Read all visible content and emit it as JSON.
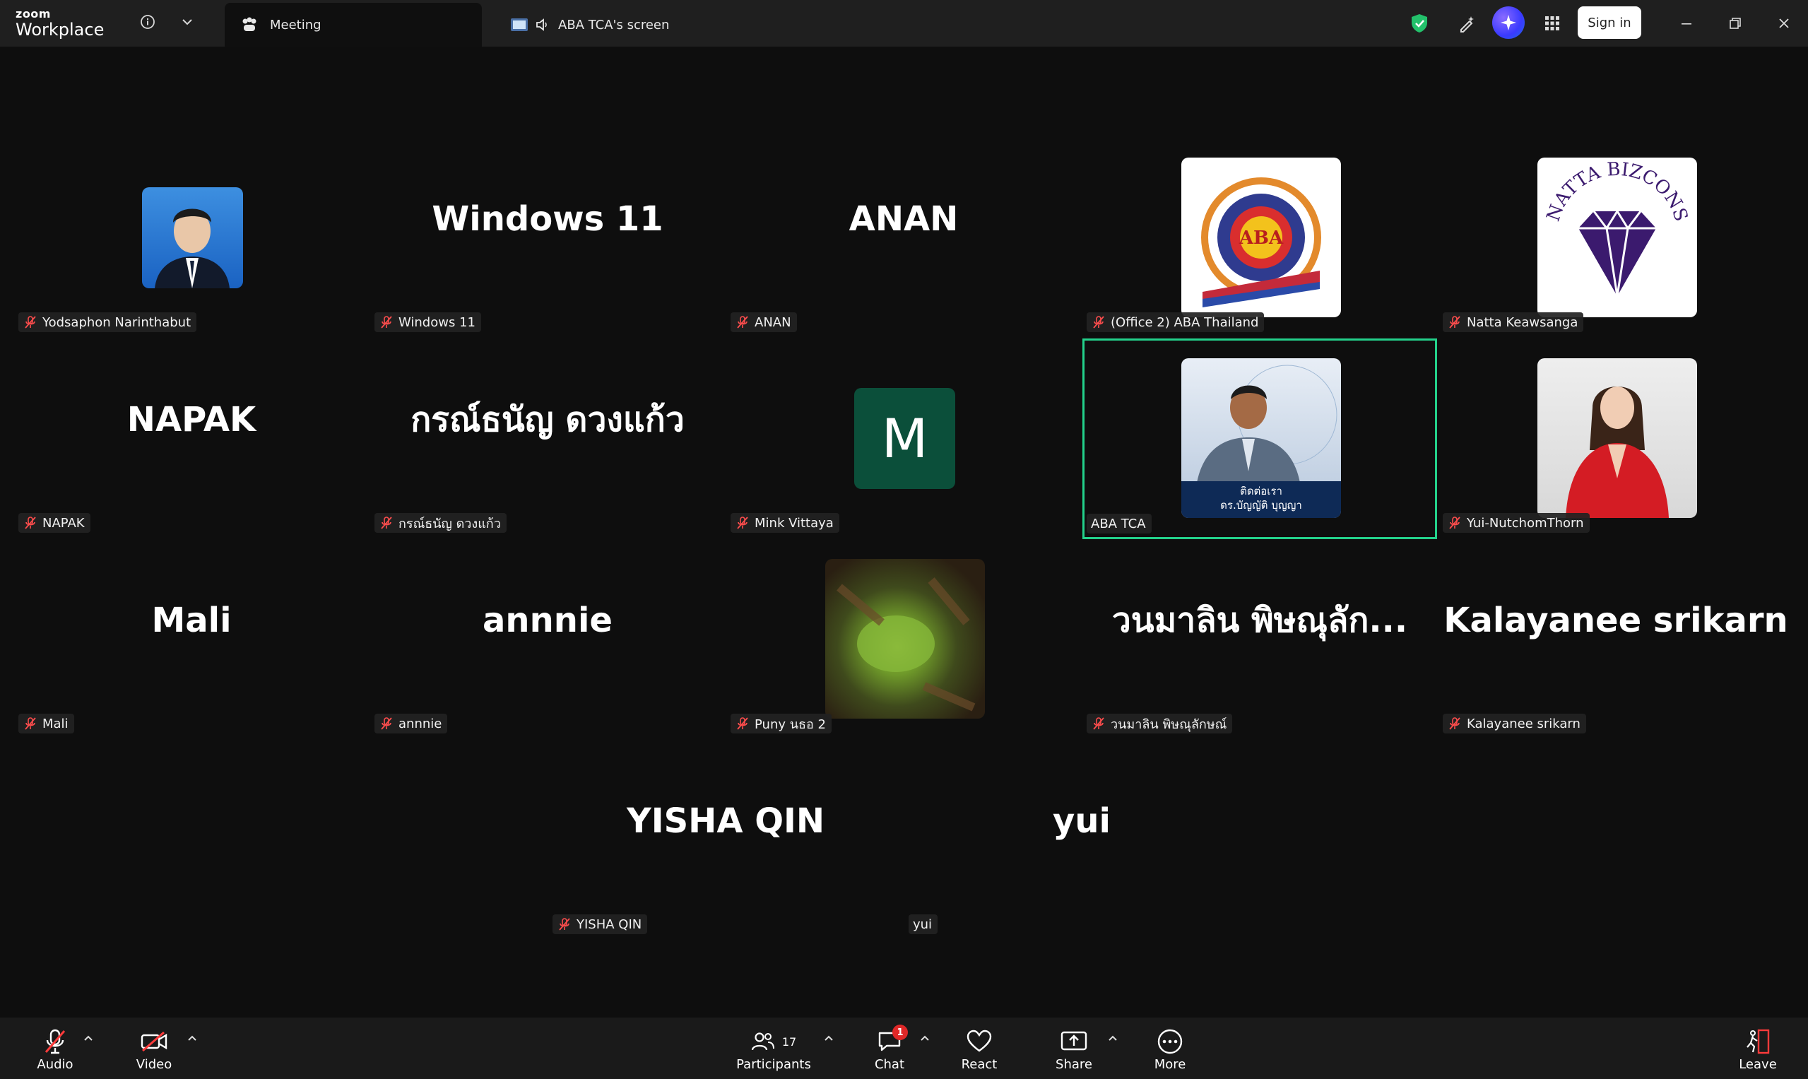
{
  "app": {
    "brand_top": "zoom",
    "brand_bottom": "Workplace"
  },
  "tabs": [
    {
      "label": "Meeting",
      "active": true
    },
    {
      "label": "ABA TCA's screen",
      "active": false
    }
  ],
  "header": {
    "sign_in": "Sign in",
    "accent": "#23d18b"
  },
  "tiles": [
    {
      "display": "",
      "name": "Yodsaphon Narinthabut",
      "muted": true
    },
    {
      "display": "Windows 11",
      "name": "Windows 11",
      "muted": true
    },
    {
      "display": "ANAN",
      "name": "ANAN",
      "muted": true
    },
    {
      "display": "",
      "name": "(Office 2) ABA Thailand",
      "muted": true,
      "logo_text": "ABA"
    },
    {
      "display": "",
      "name": "Natta Keawsanga",
      "muted": true,
      "logo_text": "NATTA BIZCONS"
    },
    {
      "display": "NAPAK",
      "name": "NAPAK",
      "muted": true
    },
    {
      "display": "กรณ์ธนัญ ดวงแก้ว",
      "name": "กรณ์ธนัญ ดวงแก้ว",
      "muted": true
    },
    {
      "display": "M",
      "name": "Mink Vittaya",
      "muted": true
    },
    {
      "display": "",
      "name": "ABA TCA",
      "muted": false,
      "active": true,
      "caption_1": "ติดต่อเรา",
      "caption_2": "ดร.บัญญัติ บุญญา"
    },
    {
      "display": "",
      "name": "Yui-NutchomThorn",
      "muted": true
    },
    {
      "display": "Mali",
      "name": "Mali",
      "muted": true
    },
    {
      "display": "annnie",
      "name": "annnie",
      "muted": true
    },
    {
      "display": "",
      "name": "Puny นธอ 2",
      "muted": true
    },
    {
      "display": "วนมาลิน  พิษณุลัก...",
      "name": "วนมาลิน  พิษณุลักษณ์",
      "muted": true
    },
    {
      "display": "Kalayanee srikarn",
      "name": "Kalayanee srikarn",
      "muted": true
    },
    {
      "display": "YISHA QIN",
      "name": "YISHA QIN",
      "muted": true
    },
    {
      "display": "yui",
      "name": "yui",
      "muted": false
    }
  ],
  "toolbar": {
    "audio": "Audio",
    "video": "Video",
    "participants": "Participants",
    "participants_count": "17",
    "chat": "Chat",
    "chat_badge": "1",
    "react": "React",
    "share": "Share",
    "more": "More",
    "leave": "Leave"
  }
}
